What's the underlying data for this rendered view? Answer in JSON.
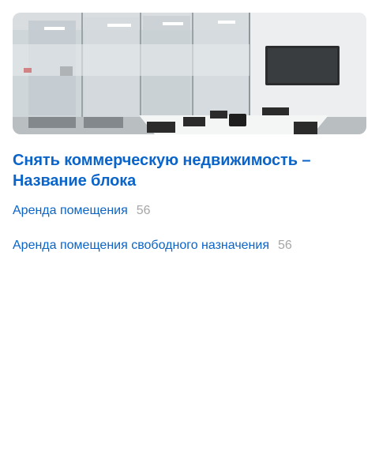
{
  "block": {
    "image_alt": "conference-room-photo",
    "title": "Снять коммерческую недвижимость – Название блока",
    "links": [
      {
        "label": "Аренда помещения",
        "count": "56"
      },
      {
        "label": "Аренда помещения свободного назначения",
        "count": "56"
      }
    ]
  },
  "colors": {
    "link": "#0a64c9",
    "count": "#a6a6a6",
    "background": "#ffffff"
  }
}
